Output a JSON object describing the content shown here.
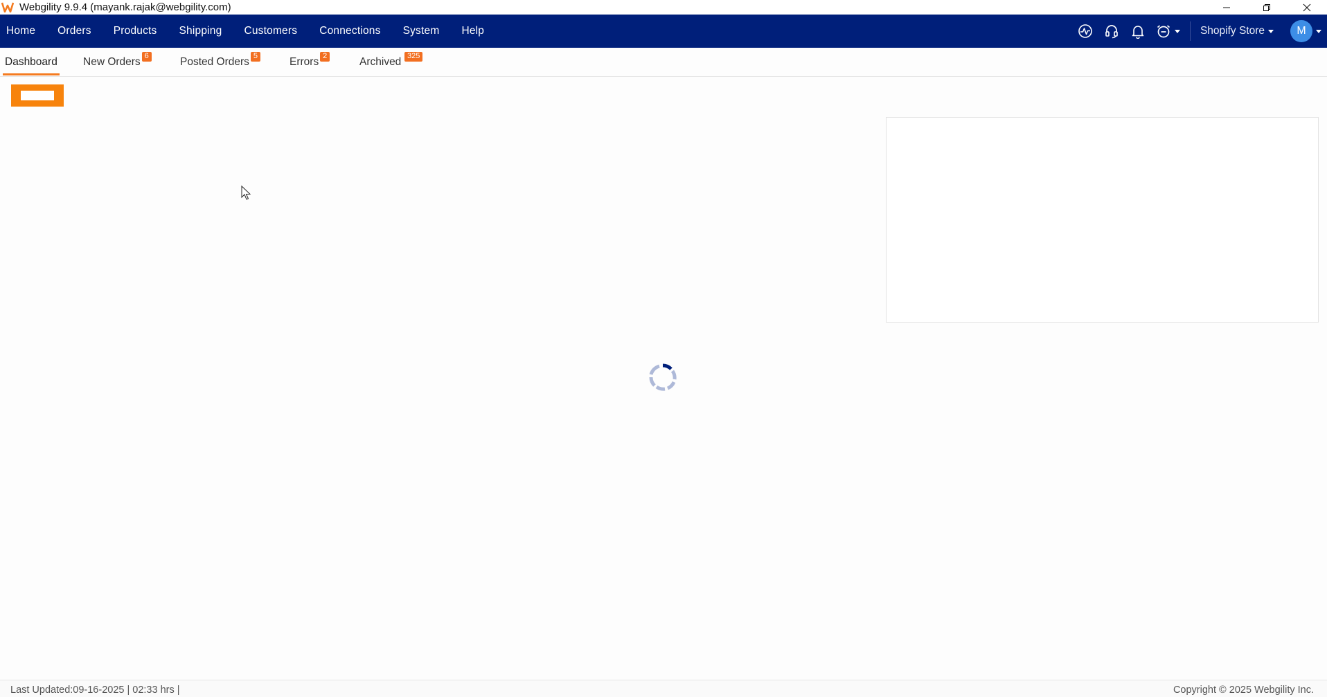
{
  "window": {
    "title": "Webgility 9.9.4 (mayank.rajak@webgility.com)"
  },
  "nav": {
    "items": [
      "Home",
      "Orders",
      "Products",
      "Shipping",
      "Customers",
      "Connections",
      "System",
      "Help"
    ],
    "store": "Shopify Store",
    "avatar_initial": "M"
  },
  "tabs": [
    {
      "label": "Dashboard",
      "badge": "",
      "active": true
    },
    {
      "label": "New Orders",
      "badge": "6"
    },
    {
      "label": "Posted Orders",
      "badge": "5"
    },
    {
      "label": "Errors",
      "badge": "2"
    },
    {
      "label": "Archived",
      "badge": "325"
    }
  ],
  "footer": {
    "last_updated": "Last Updated:09-16-2025 | 02:33 hrs |",
    "copyright": "Copyright © 2025 Webgility Inc."
  },
  "icons": {
    "app_logo": "webgility-logo-icon",
    "pulse": "activity-icon",
    "support": "headset-icon",
    "notifications": "bell-icon",
    "alarm": "alarm-clock-icon"
  },
  "colors": {
    "nav_bg": "#001f7a",
    "accent": "#f47b20",
    "badge": "#f26f21",
    "avatar": "#3d8ee6"
  }
}
